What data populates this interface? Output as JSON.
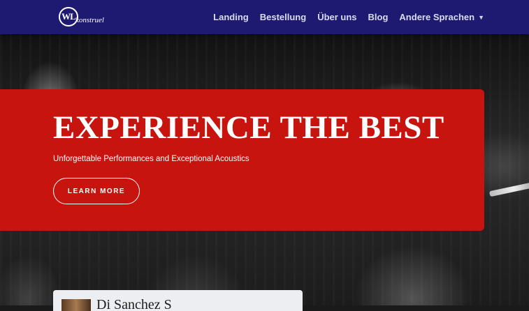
{
  "brand": {
    "mark": "WL",
    "text": "konstruel"
  },
  "nav": {
    "items": [
      {
        "label": "Landing"
      },
      {
        "label": "Bestellung"
      },
      {
        "label": "Über uns"
      },
      {
        "label": "Blog"
      },
      {
        "label": "Andere Sprachen",
        "has_dropdown": true
      }
    ]
  },
  "hero": {
    "headline": "EXPERIENCE THE BEST",
    "subline": "Unforgettable Performances and Exceptional Acoustics",
    "cta_label": "LEARN MORE"
  },
  "card": {
    "title": "Di  Sanchez  S"
  },
  "icons": {
    "dropdown": "chevron-down-icon"
  },
  "colors": {
    "nav_bg": "#1e1a72",
    "panel": "#c8140e",
    "nav_text": "#d9dcf0"
  }
}
